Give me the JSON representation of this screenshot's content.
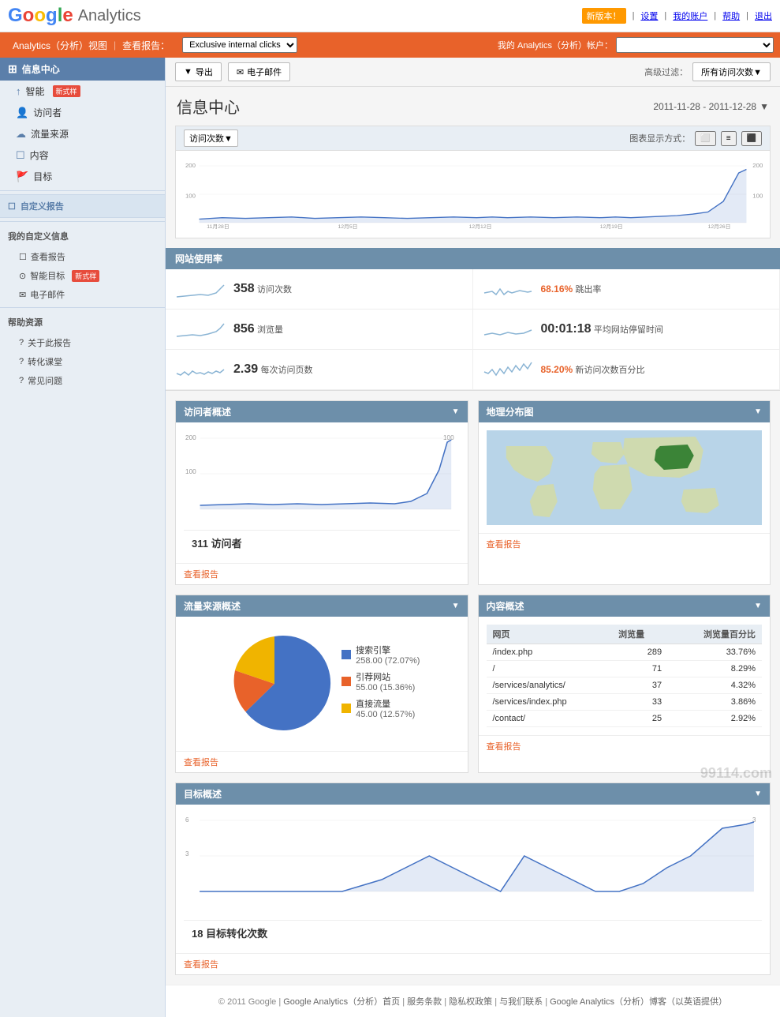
{
  "header": {
    "logo_google": "Google",
    "logo_analytics": "Analytics",
    "new_version": "新版本！",
    "settings": "设置",
    "my_account": "我的账户",
    "help": "帮助",
    "logout": "退出"
  },
  "navbar": {
    "analytics_link": "Analytics（分析）视图",
    "reports_link": "查看报告：",
    "filter_select": "Exclusive internal clicks",
    "my_analytics": "我的 Analytics（分析）帐户：",
    "account_select": ""
  },
  "sidebar": {
    "info_center": "信息中心",
    "advisor": "智能",
    "advisor_badge": "新式样",
    "visitors": "访问者",
    "traffic_sources": "流量来源",
    "content": "内容",
    "goals": "目标",
    "custom_reports": "自定义报告",
    "my_custom_info": "我的自定义信息",
    "view_reports": "查看报告",
    "smart_goals": "智能目标",
    "smart_badge": "新式样",
    "email": "电子邮件",
    "help_resources": "帮助资源",
    "about_reports": "关于此报告",
    "conversion_university": "转化课堂",
    "common_questions": "常见问题"
  },
  "toolbar": {
    "export": "导出",
    "email_btn": "电子邮件",
    "advanced_filter": "高级过滤：",
    "all_visits": "所有访问次数▼"
  },
  "page": {
    "title": "信息中心",
    "date_range": "2011-11-28 - 2011-12-28"
  },
  "main_chart": {
    "tab": "访问次数▼",
    "display_mode": "图表显示方式："
  },
  "site_stats": {
    "section_title": "网站使用率",
    "visits": {
      "number": "358",
      "label": "访问次数"
    },
    "pageviews": {
      "number": "856",
      "label": "浏览量"
    },
    "pages_per_visit": {
      "number": "2.39",
      "label": "每次访问页数"
    },
    "bounce_rate": {
      "number": "68.16%",
      "label": "跳出率"
    },
    "avg_time": {
      "number": "00:01:18",
      "label": "平均网站停留时间"
    },
    "new_visits": {
      "number": "85.20%",
      "label": "新访问次数百分比"
    }
  },
  "visitor_widget": {
    "title": "访问者概述",
    "stat": "311 访问者",
    "link": "查看报告"
  },
  "geo_widget": {
    "title": "地理分布图",
    "link": "查看报告"
  },
  "traffic_widget": {
    "title": "流量来源概述",
    "link": "查看报告",
    "legend": [
      {
        "label": "搜索引擎",
        "value": "258.00 (72.07%)",
        "color": "#4472c4"
      },
      {
        "label": "引荐网站",
        "value": "55.00 (15.36%)",
        "color": "#e8622a"
      },
      {
        "label": "直接流量",
        "value": "45.00 (12.57%)",
        "color": "#f0b400"
      }
    ]
  },
  "content_widget": {
    "title": "内容概述",
    "link": "查看报告",
    "headers": [
      "网页",
      "浏览量",
      "浏览量百分比"
    ],
    "rows": [
      {
        "page": "/index.php",
        "views": "289",
        "percent": "33.76%"
      },
      {
        "page": "/",
        "views": "71",
        "percent": "8.29%"
      },
      {
        "page": "/services/analytics/",
        "views": "37",
        "percent": "4.32%"
      },
      {
        "page": "/services/index.php",
        "views": "33",
        "percent": "3.86%"
      },
      {
        "page": "/contact/",
        "views": "25",
        "percent": "2.92%"
      }
    ]
  },
  "goal_widget": {
    "title": "目标概述",
    "stat": "18 目标转化次数",
    "link": "查看报告"
  },
  "footer": {
    "copyright": "© 2011 Google",
    "links": [
      "Google Analytics（分析）首页",
      "服务条款",
      "隐私权政策",
      "与我们联系",
      "Google Analytics（分析）博客（以英语提供）"
    ]
  },
  "watermark": "99114.com"
}
